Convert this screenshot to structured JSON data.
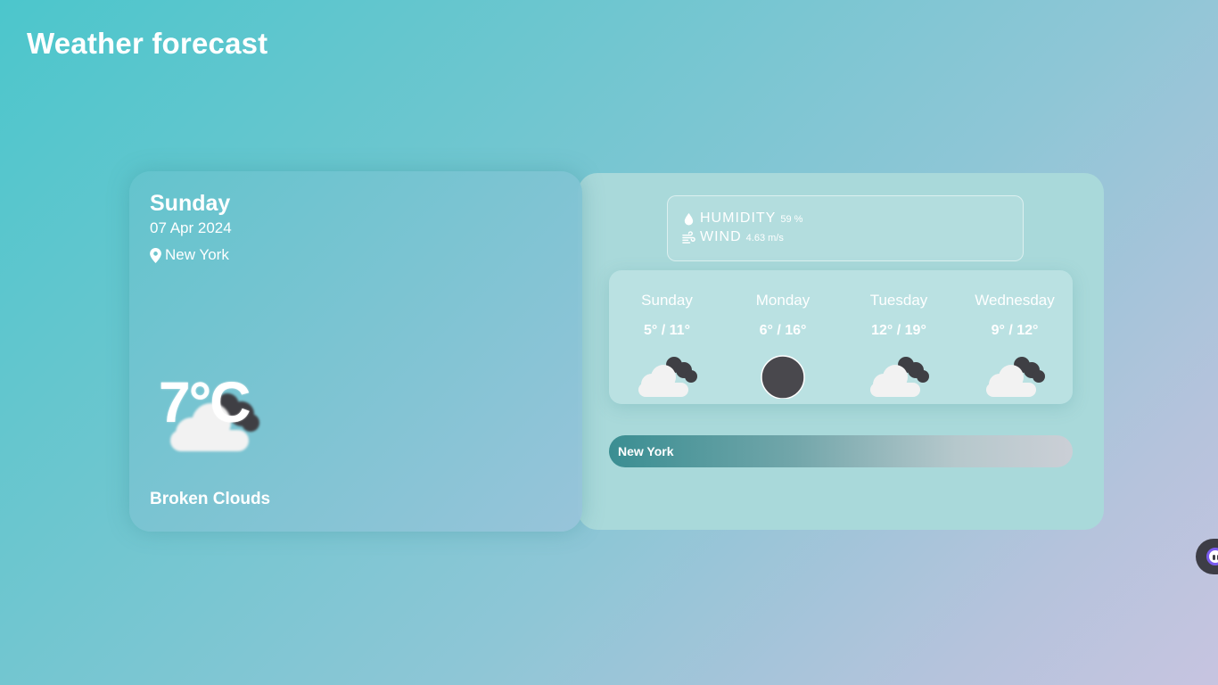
{
  "page": {
    "title": "Weather forecast"
  },
  "current": {
    "day": "Sunday",
    "date": "07 Apr 2024",
    "location": "New York",
    "temperature": "7°C",
    "condition": "Broken Clouds",
    "icon": "broken-clouds-icon"
  },
  "stats": {
    "humidity_label": "HUMIDITY",
    "humidity_value": "59 %",
    "wind_label": "WIND",
    "wind_value": "4.63 m/s"
  },
  "forecast": [
    {
      "day": "Sunday",
      "temps": "5° / 11°",
      "icon": "broken-clouds-icon"
    },
    {
      "day": "Monday",
      "temps": "6° / 16°",
      "icon": "clear-sky-icon"
    },
    {
      "day": "Tuesday",
      "temps": "12° / 19°",
      "icon": "broken-clouds-icon"
    },
    {
      "day": "Wednesday",
      "temps": "9° / 12°",
      "icon": "broken-clouds-icon"
    }
  ],
  "city_bar": {
    "label": "New York"
  },
  "colors": {
    "icon_dark": "#3f3f44",
    "cloud": "#f2f2f2",
    "panel": "#a9d9da",
    "accent_bar": "#3a8e92"
  }
}
